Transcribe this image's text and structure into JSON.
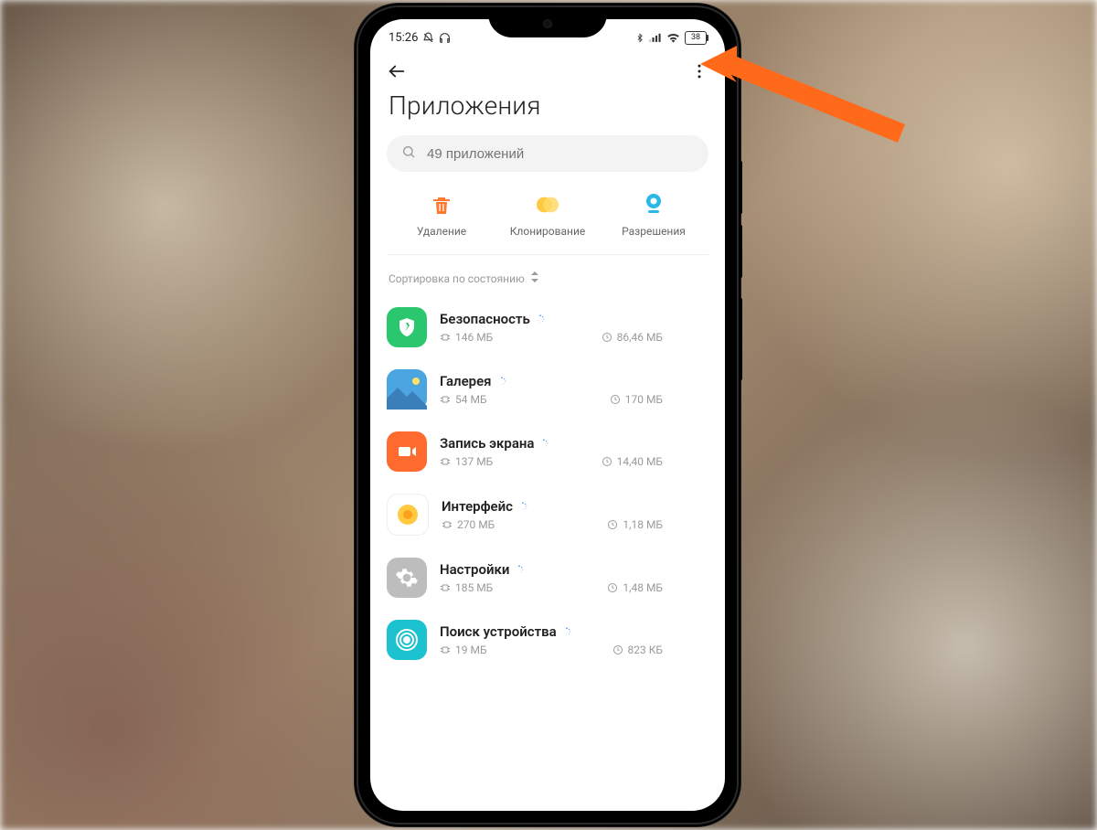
{
  "status": {
    "time": "15:26",
    "battery": "38"
  },
  "header": {
    "title": "Приложения"
  },
  "search": {
    "placeholder": "49 приложений"
  },
  "actions": {
    "delete": "Удаление",
    "clone": "Клонирование",
    "permissions": "Разрешения"
  },
  "sort": {
    "label": "Сортировка по состоянию"
  },
  "apps": [
    {
      "name": "Безопасность",
      "storage": "146 МБ",
      "data": "86,46 МБ"
    },
    {
      "name": "Галерея",
      "storage": "54 МБ",
      "data": "170 МБ"
    },
    {
      "name": "Запись экрана",
      "storage": "137 МБ",
      "data": "14,40 МБ"
    },
    {
      "name": "Интерфейс",
      "storage": "270 МБ",
      "data": "1,18 МБ"
    },
    {
      "name": "Настройки",
      "storage": "185 МБ",
      "data": "1,48 МБ"
    },
    {
      "name": "Поиск устройства",
      "storage": "19 МБ",
      "data": "823 КБ"
    }
  ]
}
